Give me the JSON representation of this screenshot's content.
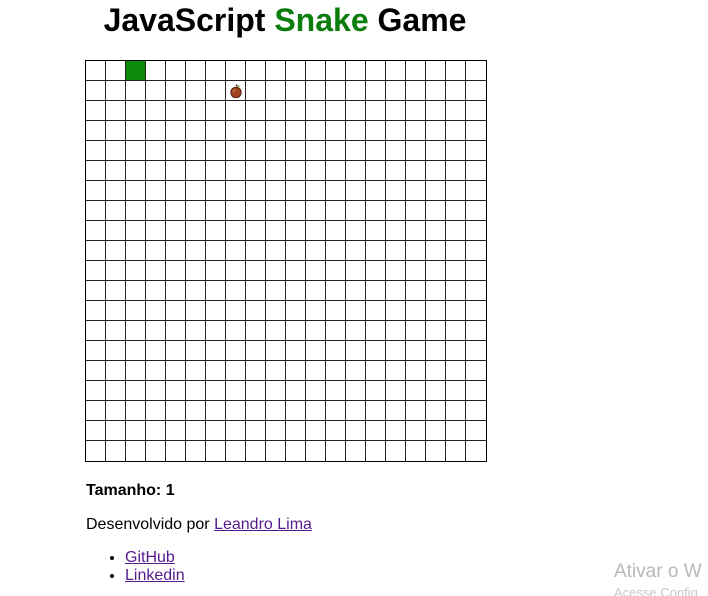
{
  "header": {
    "title_part1": "JavaScript ",
    "title_accent": "Snake",
    "title_part3": " Game",
    "accent_color": "#0a7d0a"
  },
  "game": {
    "rows": 20,
    "cols": 20,
    "snake": [
      {
        "row": 0,
        "col": 2
      }
    ],
    "apple": {
      "row": 1,
      "col": 7
    },
    "snake_color": "#0b8a0b",
    "apple_icon": "apple-icon"
  },
  "score": {
    "text": "Tamanho: 1"
  },
  "credit": {
    "prefix": "Desenvolvido por ",
    "author": "Leandro Lima"
  },
  "links": [
    {
      "label": "GitHub"
    },
    {
      "label": "Linkedin"
    }
  ],
  "watermark": {
    "line1": "Ativar o W",
    "line2": "Acesse Config"
  }
}
